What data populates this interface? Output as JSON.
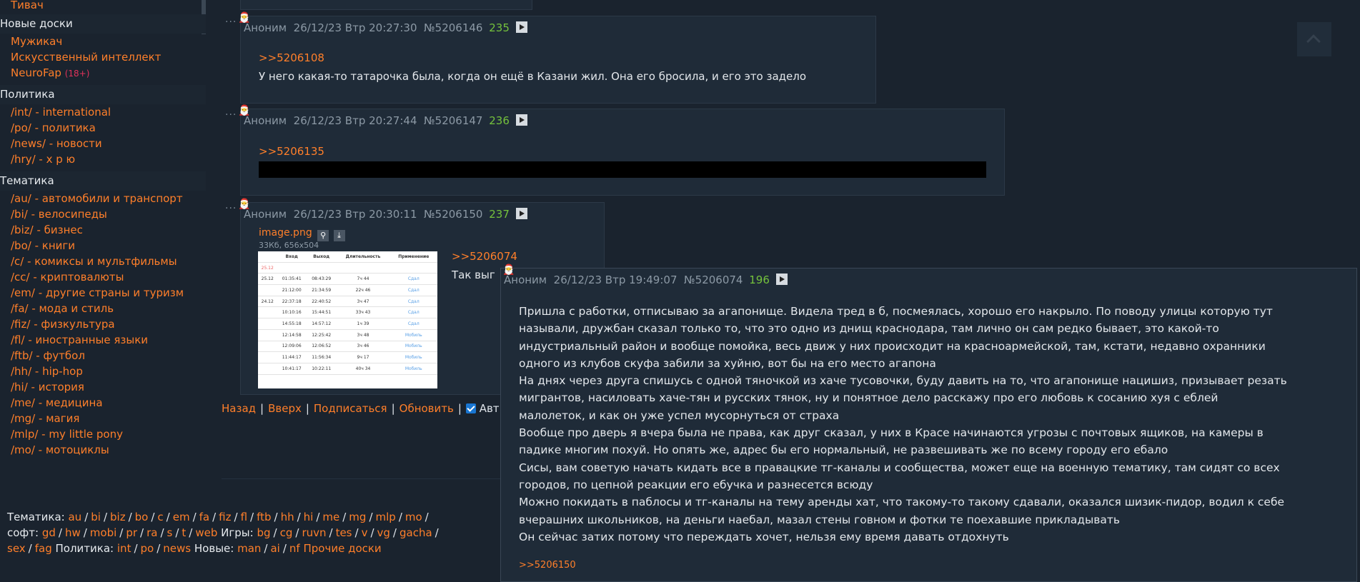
{
  "sidebar": {
    "top_items": [
      "Тивач"
    ],
    "sections": [
      {
        "title": "Новые доски",
        "items": [
          {
            "label": "Мужикач",
            "badge": ""
          },
          {
            "label": "Искусственный интеллект",
            "badge": ""
          },
          {
            "label": "NeuroFap",
            "badge": "(18+)"
          }
        ]
      },
      {
        "title": "Политика",
        "items": [
          {
            "label": "/int/ - international"
          },
          {
            "label": "/po/ - политика"
          },
          {
            "label": "/news/ - новости"
          },
          {
            "label": "/hry/ - х р ю"
          }
        ]
      },
      {
        "title": "Тематика",
        "items": [
          {
            "label": "/au/ - автомобили и транспорт"
          },
          {
            "label": "/bi/ - велосипеды"
          },
          {
            "label": "/biz/ - бизнес"
          },
          {
            "label": "/bo/ - книги"
          },
          {
            "label": "/c/ - комиксы и мультфильмы"
          },
          {
            "label": "/cc/ - криптовалюты"
          },
          {
            "label": "/em/ - другие страны и туризм"
          },
          {
            "label": "/fa/ - мода и стиль"
          },
          {
            "label": "/fiz/ - физкультура"
          },
          {
            "label": "/fl/ - иностранные языки"
          },
          {
            "label": "/ftb/ - футбол"
          },
          {
            "label": "/hh/ - hip-hop"
          },
          {
            "label": "/hi/ - история"
          },
          {
            "label": "/me/ - медицина"
          },
          {
            "label": "/mg/ - магия"
          },
          {
            "label": "/mlp/ - my little pony"
          },
          {
            "label": "/mo/ - мотоциклы"
          }
        ]
      }
    ]
  },
  "posts": [
    {
      "author": "Аноним",
      "date": "26/12/23 Втр 20:27:30",
      "num": "№5206146",
      "count": "235",
      "reply": ">>5206108",
      "text": "У него какая-то татарочка была, когда он ещё в Казани жил. Она его бросила, и его это задело"
    },
    {
      "author": "Аноним",
      "date": "26/12/23 Втр 20:27:44",
      "num": "№5206147",
      "count": "236",
      "reply": ">>5206135",
      "text": ""
    },
    {
      "author": "Аноним",
      "date": "26/12/23 Втр 20:30:11",
      "num": "№5206150",
      "count": "237",
      "file_name": "image.png",
      "file_meta": "33Кб, 656x504",
      "reply": ">>5206074",
      "text": "Так выг"
    }
  ],
  "thumbnail": {
    "headers": [
      "",
      "Вход",
      "Выход",
      "Длительность",
      "Применение"
    ],
    "rows": [
      [
        "25.12",
        "",
        "",
        "",
        ""
      ],
      [
        "25.12",
        "01:35:41",
        "08:43:29",
        "7ч 44",
        "Сдал"
      ],
      [
        "",
        "21:12:00",
        "21:34:59",
        "22ч 46",
        "Сдал"
      ],
      [
        "24.12",
        "22:37:18",
        "22:40:52",
        "3ч 47",
        "Сдал"
      ],
      [
        "",
        "10:10:16",
        "15:44:51",
        "33ч 43",
        "Сдал"
      ],
      [
        "",
        "14:55:18",
        "14:57:12",
        "1ч 39",
        "Сдал"
      ],
      [
        "",
        "12:14:58",
        "12:25:42",
        "3ч 48",
        "Мобиль"
      ],
      [
        "",
        "12:09:06",
        "12:06:52",
        "3ч 46",
        "Мобиль"
      ],
      [
        "",
        "11:44:17",
        "11:56:34",
        "9ч 17",
        "Мобиль"
      ],
      [
        "",
        "10:41:17",
        "10:22:11",
        "40ч 34",
        "Мобиль"
      ]
    ]
  },
  "popup": {
    "author": "Аноним",
    "date": "26/12/23 Втр 19:49:07",
    "num": "№5206074",
    "count": "196",
    "lines": [
      "Пришла с работки, отписываю за агапонище. Видела тред в б, посмеялась, хорошо его накрыло. По поводу улицы которую тут",
      "называли, дружбан сказал только то, что это одно из днищ краснодара, там лично он сам редко бывает, это какой-то",
      "индустриальный район и вообще помойка, весь движ у них происходит на красноармейской, там, кстати, недавно охранники",
      "одного из клубов скуфа забили за хуйню, вот бы на его место агапона",
      "На днях через друга спишусь с одной тяночкой из хаче тусовочки, буду давить на то, что агапонище нацишиз, призывает резать",
      "мигрантов, насиловать хаче-тян и русских тянок, ну и понятное дело расскажу про его любовь к сосанию хуя с еблей",
      "малолеток, и как он уже успел мусорнуться от страха",
      "Вообще про дверь я вчера была не права, как друг сказал, у них в Красе начинаются угрозы с почтовых ящиков, на камеры в",
      "падике многим похуй. Но опять же, адрес бы его нормальный, не развешивать же по всему городу его ебало",
      "Сисы, вам советую начать кидать все в правацкие тг-каналы и сообщества, может еще на военную тематику, там сидят со всех",
      "городов, по цепной реакции его ебучка и разнесется всюду",
      "Можно покидать в паблосы и тг-каналы на тему аренды хат, что такому-то такому сдавали, оказался шизик-пидор, водил к себе",
      "вчерашних школьников, на деньги наебал, мазал стены говном и фотки те поехавшие прикладывать",
      "Он сейчас затих потому что переждать хочет, нельзя ему время давать отдохнуть"
    ],
    "backlink": ">>5206150"
  },
  "nav": {
    "back": "Назад",
    "top": "Вверх",
    "subscribe": "Подписаться",
    "refresh": "Обновить",
    "auto": "Авт"
  },
  "footer": {
    "tematika_label": "Тематика:",
    "tematika": [
      "au",
      "bi",
      "biz",
      "bo",
      "c",
      "em",
      "fa",
      "fiz",
      "fl",
      "ftb",
      "hh",
      "hi",
      "me",
      "mg",
      "mlp",
      "mo"
    ],
    "soft_label": "софт:",
    "soft": [
      "gd",
      "hw",
      "mobi",
      "pr",
      "ra",
      "s",
      "t",
      "web"
    ],
    "games_label": "Игры:",
    "games": [
      "bg",
      "cg",
      "ruvn",
      "tes",
      "v",
      "vg",
      "gacha"
    ],
    "misc": [
      "sex",
      "fag"
    ],
    "politics_label": "Политика:",
    "politics": [
      "int",
      "po",
      "news"
    ],
    "new_label": "Новые:",
    "new": [
      "man",
      "ai",
      "nf"
    ],
    "other": "Прочие доски"
  }
}
